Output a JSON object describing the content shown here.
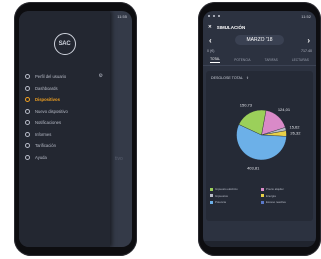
{
  "left_phone": {
    "status_time": "11:55",
    "logo_text": "SAC",
    "menu": [
      {
        "label": "Perfil del usuario",
        "icon": "user-icon",
        "active": false
      },
      {
        "label": "Dashboards",
        "icon": "dashboard-icon",
        "active": false
      },
      {
        "label": "Dispositivos",
        "icon": "devices-icon",
        "active": true
      },
      {
        "label": "Nuevo dispositivo",
        "icon": "add-icon",
        "active": false
      },
      {
        "label": "Notificaciones",
        "icon": "bell-icon",
        "active": false
      },
      {
        "label": "Informes",
        "icon": "report-icon",
        "active": false
      },
      {
        "label": "Tarificación",
        "icon": "tariff-icon",
        "active": false
      },
      {
        "label": "Ayuda",
        "icon": "help-icon",
        "active": false
      }
    ],
    "background_text": "tivo",
    "colors": {
      "active": "#f0a020",
      "drawer": "#232731"
    }
  },
  "right_phone": {
    "status_time": "11:52",
    "title": "SIMULACIÓN",
    "month": "MARZO '18",
    "info_left": "0 (€)",
    "info_right": "717.40",
    "tabs": [
      "TOTAL",
      "POTENCIA",
      "TARIFAS",
      "LECTURAS"
    ],
    "active_tab": "TOTAL",
    "card_title": "DESGLOSE TOTAL"
  },
  "chart_data": {
    "type": "pie",
    "slices": [
      {
        "name": "Impuesto eléctrico",
        "value": 124.01,
        "label": "124,01",
        "color": "#d98ac8"
      },
      {
        "name": "Precio alquiler",
        "value": 15.62,
        "label": "15,62",
        "color": "#b8bcc8"
      },
      {
        "name": "Impuestos",
        "value": 26.32,
        "label": "26,32",
        "color": "#e8d048"
      },
      {
        "name": "Energía",
        "value": 403.81,
        "label": "403,81",
        "color": "#6cb0e8"
      },
      {
        "name": "Potencia",
        "value": 150.73,
        "label": "150,73",
        "color": "#9bd05a"
      },
      {
        "name": "Exceso reactiva",
        "value": 0,
        "label": "",
        "color": "#5a78c8"
      }
    ],
    "legend": [
      {
        "name": "Impuesto eléctrico",
        "color": "#9bd05a"
      },
      {
        "name": "Precio alquiler",
        "color": "#d98ac8"
      },
      {
        "name": "Impuestos",
        "color": "#b8bcc8"
      },
      {
        "name": "Energía",
        "color": "#e8d048"
      },
      {
        "name": "Potencia",
        "color": "#6cb0e8"
      },
      {
        "name": "Exceso reactiva",
        "color": "#5a78c8"
      }
    ]
  }
}
